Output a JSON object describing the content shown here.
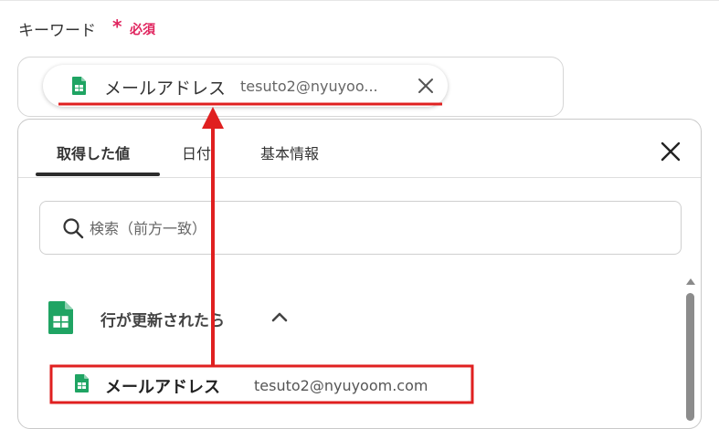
{
  "field": {
    "label": "キーワード",
    "required_mark": "*",
    "required_text": "必須"
  },
  "chip": {
    "label": "メールアドレス",
    "value": "tesuto2@nyuyoo...",
    "close_icon": "close-icon"
  },
  "tabs": [
    {
      "label": "取得した値",
      "active": true
    },
    {
      "label": "日付",
      "active": false
    },
    {
      "label": "基本情報",
      "active": false
    }
  ],
  "search": {
    "placeholder": "検索（前方一致）"
  },
  "section": {
    "title": "行が更新されたら",
    "icon": "google-sheets-icon"
  },
  "result": {
    "label": "メールアドレス",
    "value": "tesuto2@nyuyoom.com"
  },
  "colors": {
    "required": "#e0245e",
    "annotation": "#e02020",
    "sheets_green": "#1fa463"
  }
}
